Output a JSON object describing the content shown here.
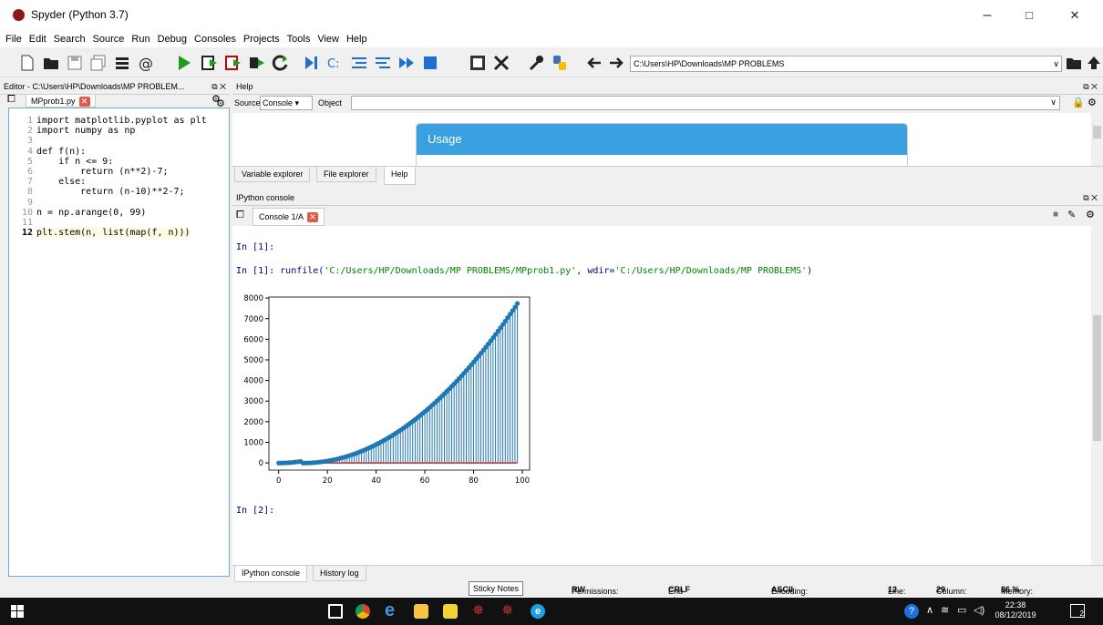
{
  "window": {
    "title": "Spyder (Python 3.7)",
    "minimize": "–",
    "maximize": "□",
    "close": "✕"
  },
  "menu": [
    "File",
    "Edit",
    "Search",
    "Source",
    "Run",
    "Debug",
    "Consoles",
    "Projects",
    "Tools",
    "View",
    "Help"
  ],
  "toolbar": {
    "path": "C:\\Users\\HP\\Downloads\\MP PROBLEMS"
  },
  "editor": {
    "pane_title": "Editor - C:\\Users\\HP\\Downloads\\MP PROBLEM...",
    "tab": "MPprob1.py",
    "lines": [
      {
        "n": "1",
        "text": "import matplotlib.pyplot as plt"
      },
      {
        "n": "2",
        "text": "import numpy as np"
      },
      {
        "n": "3",
        "text": ""
      },
      {
        "n": "4",
        "text": "def f(n):"
      },
      {
        "n": "5",
        "text": "    if n <= 9:"
      },
      {
        "n": "6",
        "text": "        return (n**2)-7;"
      },
      {
        "n": "7",
        "text": "    else:"
      },
      {
        "n": "8",
        "text": "        return (n-10)**2-7;"
      },
      {
        "n": "9",
        "text": ""
      },
      {
        "n": "10",
        "text": "n = np.arange(0, 99)"
      },
      {
        "n": "11",
        "text": ""
      },
      {
        "n": "12",
        "text": "plt.stem(n, list(map(f, n)))"
      }
    ]
  },
  "help": {
    "pane_title": "Help",
    "source_label": "Source",
    "source_value": "Console",
    "object_label": "Object",
    "usage": "Usage",
    "tabs": [
      "Variable explorer",
      "File explorer",
      "Help"
    ]
  },
  "console": {
    "pane_title": "IPython console",
    "tab": "Console 1/A",
    "in1": "In [1]:",
    "in1_cmd_prefix": "In [1]: runfile(",
    "in1_arg1": "'C:/Users/HP/Downloads/MP PROBLEMS/MPprob1.py'",
    "in1_mid": ", wdir=",
    "in1_arg2": "'C:/Users/HP/Downloads/MP PROBLEMS'",
    "in1_end": ")",
    "in2": "In [2]:",
    "bottom_tabs": [
      "IPython console",
      "History log"
    ]
  },
  "chart_data": {
    "type": "stem",
    "x_formula": "n = 0..98",
    "y_formula": "n<=9: n^2-7; else (n-10)^2-7",
    "xticks": [
      "0",
      "20",
      "40",
      "60",
      "80",
      "100"
    ],
    "yticks": [
      "0",
      "1000",
      "2000",
      "3000",
      "4000",
      "5000",
      "6000",
      "7000",
      "8000"
    ],
    "xlim": [
      -4,
      103
    ],
    "ylim": [
      -350,
      8050
    ],
    "stem_color": "#1f77b4",
    "baseline_color": "#d62728"
  },
  "tooltip": "Sticky Notes",
  "status": {
    "permissions_label": "Permissions:",
    "permissions": "RW",
    "eol_label": "End-of-lines:",
    "eol": "CRLF",
    "encoding_label": "Encoding:",
    "encoding": "ASCII",
    "line_label": "Line:",
    "line": "12",
    "column_label": "Column:",
    "column": "29",
    "memory_label": "Memory:",
    "memory": "86 %"
  },
  "taskbar": {
    "time": "22:38",
    "date": "08/12/2019",
    "notifications": "2"
  }
}
